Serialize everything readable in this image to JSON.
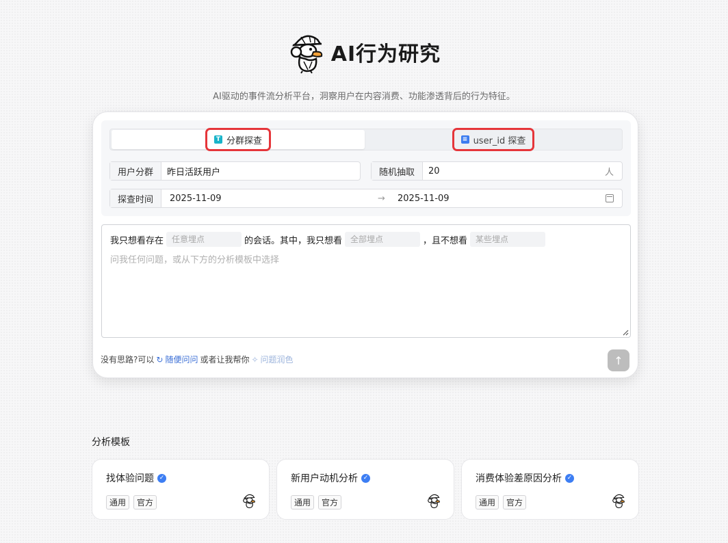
{
  "header": {
    "title": "AI行为研究",
    "subtitle": "AI驱动的事件流分析平台，洞察用户在内容消费、功能渗透背后的行为特征。"
  },
  "tabs": [
    {
      "label": "分群探查",
      "icon": "T",
      "active": true
    },
    {
      "label": "user_id 探查",
      "icon": "doc-icon",
      "active": false
    }
  ],
  "form": {
    "group_label": "用户分群",
    "group_value": "昨日活跃用户",
    "sample_label": "随机抽取",
    "sample_value": "20",
    "sample_unit": "人",
    "time_label": "探查时间",
    "date_start": "2025-11-09",
    "date_end": "2025-11-09",
    "arrow": "→"
  },
  "editor": {
    "part1": "我只想看存在",
    "chip1": "任意埋点",
    "part2": "的会话。其中，我只想看",
    "chip2": "全部埋点",
    "part3": "，且不想看",
    "chip3": "某些埋点",
    "placeholder": "问我任何问题，或从下方的分析模板中选择"
  },
  "tips": {
    "lead": "没有思路?可以",
    "random_ask": "随便问问",
    "middle": "或者让我帮你",
    "polish": "问题润色"
  },
  "templates": {
    "title": "分析模板",
    "items": [
      {
        "name": "找体验问题",
        "tags": [
          "通用",
          "官方"
        ]
      },
      {
        "name": "新用户动机分析",
        "tags": [
          "通用",
          "官方"
        ]
      },
      {
        "name": "消费体验差原因分析",
        "tags": [
          "通用",
          "官方"
        ]
      }
    ]
  },
  "colors": {
    "highlight": "#e5353a",
    "accent": "#3b6fd6",
    "verified": "#3d7ef3"
  }
}
